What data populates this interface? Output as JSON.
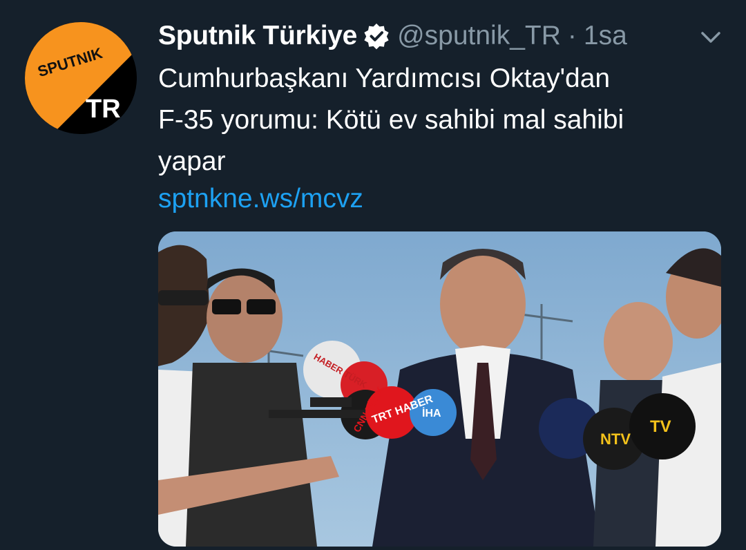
{
  "tweet": {
    "author_name": "Sputnik Türkiye",
    "handle": "@sputnik_TR",
    "separator": "·",
    "time": "1sa",
    "text_lines": [
      "Cumhurbaşkanı Yardımcısı Oktay'dan",
      "F-35 yorumu: Kötü ev sahibi mal sahibi",
      "yapar"
    ],
    "link": "sptnkne.ws/mcvz"
  },
  "avatar": {
    "logo_word": "SPUTNIK",
    "logo_suffix": "TR"
  },
  "media": {
    "mic_flags": [
      "HABER TÜRK",
      "CNN TÜRK",
      "TRT HABER",
      "İHA",
      "NTV",
      "TV"
    ]
  },
  "colors": {
    "background": "#15202b",
    "accent_link": "#1da1f2",
    "muted": "#8899a6",
    "logo_orange": "#f7931e"
  }
}
